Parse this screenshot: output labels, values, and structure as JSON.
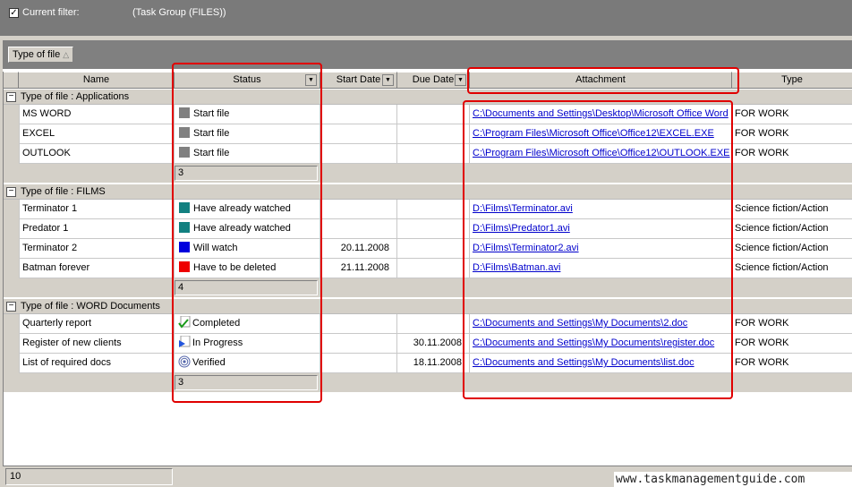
{
  "filter": {
    "checked": true,
    "label": "Current filter:",
    "value": "(Task Group  (FILES))"
  },
  "group_chip": {
    "label": "Type of file"
  },
  "columns": {
    "name": "Name",
    "status": "Status",
    "start": "Start Date",
    "due": "Due Date",
    "attachment": "Attachment",
    "type": "Type"
  },
  "groups": [
    {
      "title": "Type of file : Applications",
      "count": "3",
      "rows": [
        {
          "name": "MS WORD",
          "status": "Start file",
          "status_color": "#808080",
          "start": "",
          "due": "",
          "attachment": "C:\\Documents and Settings\\Desktop\\Microsoft Office Word",
          "type": "FOR WORK"
        },
        {
          "name": "EXCEL",
          "status": "Start file",
          "status_color": "#808080",
          "start": "",
          "due": "",
          "attachment": "C:\\Program Files\\Microsoft Office\\Office12\\EXCEL.EXE",
          "type": "FOR WORK"
        },
        {
          "name": "OUTLOOK",
          "status": "Start file",
          "status_color": "#808080",
          "start": "",
          "due": "",
          "attachment": "C:\\Program Files\\Microsoft Office\\Office12\\OUTLOOK.EXE",
          "type": "FOR WORK"
        }
      ]
    },
    {
      "title": "Type of file : FILMS",
      "count": "4",
      "rows": [
        {
          "name": "Terminator 1",
          "status": "Have already watched",
          "status_color": "#128080",
          "start": "",
          "due": "",
          "attachment": "D:\\Films\\Terminator.avi",
          "type": "Science fiction/Action"
        },
        {
          "name": "Predator 1",
          "status": "Have already watched",
          "status_color": "#128080",
          "start": "",
          "due": "",
          "attachment": "D:\\Films\\Predator1.avi",
          "type": "Science fiction/Action"
        },
        {
          "name": "Terminator 2",
          "status": "Will watch",
          "status_color": "#0000dd",
          "start": "20.11.2008",
          "due": "",
          "attachment": "D:\\Films\\Terminator2.avi",
          "type": "Science fiction/Action"
        },
        {
          "name": "Batman forever",
          "status": "Have to be deleted",
          "status_color": "#ee0000",
          "start": "21.11.2008",
          "due": "",
          "attachment": "D:\\Films\\Batman.avi",
          "type": "Science fiction/Action"
        }
      ]
    },
    {
      "title": "Type of file : WORD Documents",
      "count": "3",
      "rows": [
        {
          "name": "Quarterly report",
          "status": "Completed",
          "status_icon": "checkmark-icon",
          "start": "",
          "due": "",
          "attachment": "C:\\Documents and Settings\\My Documents\\2.doc",
          "type": "FOR WORK"
        },
        {
          "name": "Register of new clients",
          "status": "In Progress",
          "status_icon": "progress-arrow-icon",
          "start": "",
          "due": "30.11.2008",
          "attachment": "C:\\Documents and Settings\\My Documents\\register.doc",
          "type": "FOR WORK"
        },
        {
          "name": "List of required docs",
          "status": "Verified",
          "status_icon": "target-icon",
          "start": "",
          "due": "18.11.2008",
          "attachment": "C:\\Documents and Settings\\My Documents\\list.doc",
          "type": "FOR WORK"
        }
      ]
    }
  ],
  "statusbar": {
    "count": "10"
  },
  "watermark": "www.taskmanagementguide.com"
}
